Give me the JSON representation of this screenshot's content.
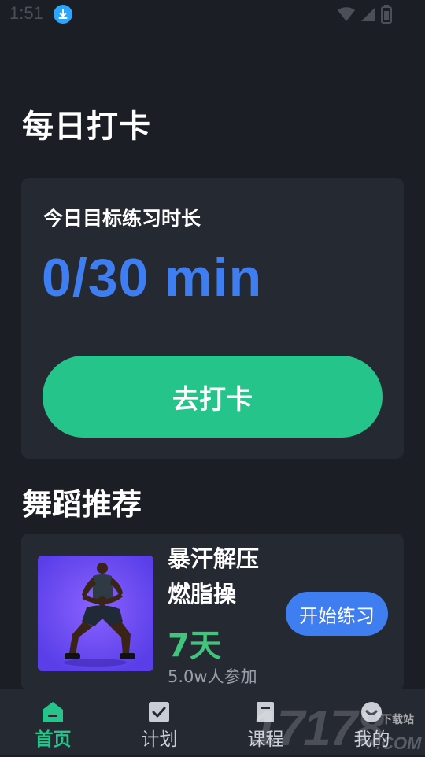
{
  "status_bar": {
    "time": "1:51"
  },
  "header": {
    "title": "每日打卡"
  },
  "checkin_card": {
    "goal_label": "今日目标练习时长",
    "goal_value": "0/30 min",
    "button_label": "去打卡"
  },
  "dance_section": {
    "title": "舞蹈推荐",
    "card": {
      "title_line1": "暴汗解压",
      "title_line2": "燃脂操",
      "duration": "7天",
      "participants": "5.0w人参加",
      "start_label": "开始练习"
    }
  },
  "tabbar": {
    "tabs": [
      {
        "label": "首页",
        "icon": "home-icon",
        "active": true
      },
      {
        "label": "计划",
        "icon": "plan-check-icon",
        "active": false
      },
      {
        "label": "课程",
        "icon": "course-icon",
        "active": false
      },
      {
        "label": "我的",
        "icon": "profile-icon",
        "active": false
      }
    ]
  },
  "watermark": {
    "number": "17178",
    "site": "下载站",
    "domain": ".COM"
  },
  "colors": {
    "background": "#1b1e25",
    "card": "#252932",
    "accent_green": "#25c48a",
    "accent_blue": "#3f7ef1",
    "duration_green": "#3fc57c"
  }
}
